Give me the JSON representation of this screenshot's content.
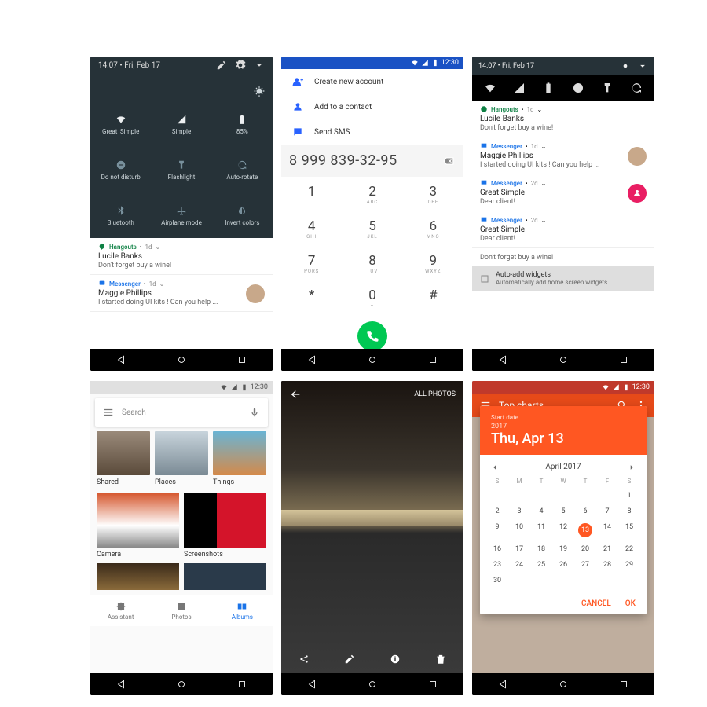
{
  "status_time": "12:30",
  "qs": {
    "clock": "14:07",
    "date": "Fri, Feb 17",
    "tiles": [
      {
        "name": "wifi",
        "label": "Great_Simple"
      },
      {
        "name": "cellular",
        "label": "Simple"
      },
      {
        "name": "battery",
        "label": "85%"
      },
      {
        "name": "dnd",
        "label": "Do not disturb"
      },
      {
        "name": "flashlight",
        "label": "Flashlight"
      },
      {
        "name": "rotate",
        "label": "Auto-rotate"
      },
      {
        "name": "bluetooth",
        "label": "Bluetooth"
      },
      {
        "name": "airplane",
        "label": "Airplane mode"
      },
      {
        "name": "invert",
        "label": "Invert colors"
      }
    ],
    "notifs": [
      {
        "app": "Hangouts",
        "time": "1d",
        "title": "Lucile Banks",
        "body": "Don't forget buy a wine!"
      },
      {
        "app": "Messenger",
        "time": "1d",
        "title": "Maggie Phillips",
        "body": "I started doing UI kits ! Can you help ..."
      }
    ]
  },
  "dialer": {
    "actions": [
      "Create new account",
      "Add to a contact",
      "Send SMS"
    ],
    "number": "8 999 839-32-95",
    "keys": [
      {
        "d": "1",
        "l": ""
      },
      {
        "d": "2",
        "l": "ABC"
      },
      {
        "d": "3",
        "l": "DEF"
      },
      {
        "d": "4",
        "l": "GHI"
      },
      {
        "d": "5",
        "l": "JKL"
      },
      {
        "d": "6",
        "l": "MNO"
      },
      {
        "d": "7",
        "l": "PQRS"
      },
      {
        "d": "8",
        "l": "TUV"
      },
      {
        "d": "9",
        "l": "WXYZ"
      },
      {
        "d": "*",
        "l": ""
      },
      {
        "d": "0",
        "l": "+"
      },
      {
        "d": "#",
        "l": ""
      }
    ]
  },
  "shade": {
    "notifs": [
      {
        "app": "Hangouts",
        "time": "1d",
        "title": "Lucile Banks",
        "body": "Don't forget buy a wine!"
      },
      {
        "app": "Messenger",
        "time": "1d",
        "title": "Maggie Phillips",
        "body": "I started doing UI kits ! Can you help ..."
      },
      {
        "app": "Messenger",
        "time": "2d",
        "title": "Great Simple",
        "body": "Dear client!"
      },
      {
        "app": "Messenger",
        "time": "2d",
        "title": "Great Simple",
        "body": "Dear client!"
      },
      {
        "app": "",
        "time": "",
        "title": "",
        "body": "Don't forget buy a wine!"
      }
    ],
    "auto_title": "Auto-add widgets",
    "auto_body": "Automatically add home screen widgets"
  },
  "photos": {
    "search_placeholder": "Search",
    "albums1": [
      {
        "label": "Shared"
      },
      {
        "label": "Places"
      },
      {
        "label": "Things"
      }
    ],
    "albums2": [
      {
        "label": "Camera"
      },
      {
        "label": "Screenshots"
      }
    ],
    "tabs": [
      {
        "label": "Assistant"
      },
      {
        "label": "Photos"
      },
      {
        "label": "Albums"
      }
    ]
  },
  "viewer": {
    "all": "ALL PHOTOS"
  },
  "picker": {
    "screen_title": "Top charts",
    "start_label": "Start date",
    "year": "2017",
    "date": "Thu, Apr 13",
    "month": "April 2017",
    "dow": [
      "S",
      "M",
      "T",
      "W",
      "T",
      "F",
      "S"
    ],
    "weeks": [
      [
        "",
        "",
        "",
        "",
        "",
        "",
        1
      ],
      [
        2,
        3,
        4,
        5,
        6,
        7,
        8
      ],
      [
        9,
        10,
        11,
        12,
        13,
        14,
        15
      ],
      [
        16,
        17,
        18,
        19,
        20,
        21,
        22
      ],
      [
        23,
        24,
        25,
        26,
        27,
        28,
        29
      ],
      [
        30,
        "",
        "",
        "",
        "",
        "",
        ""
      ]
    ],
    "selected": 13,
    "cancel": "CANCEL",
    "ok": "OK"
  }
}
